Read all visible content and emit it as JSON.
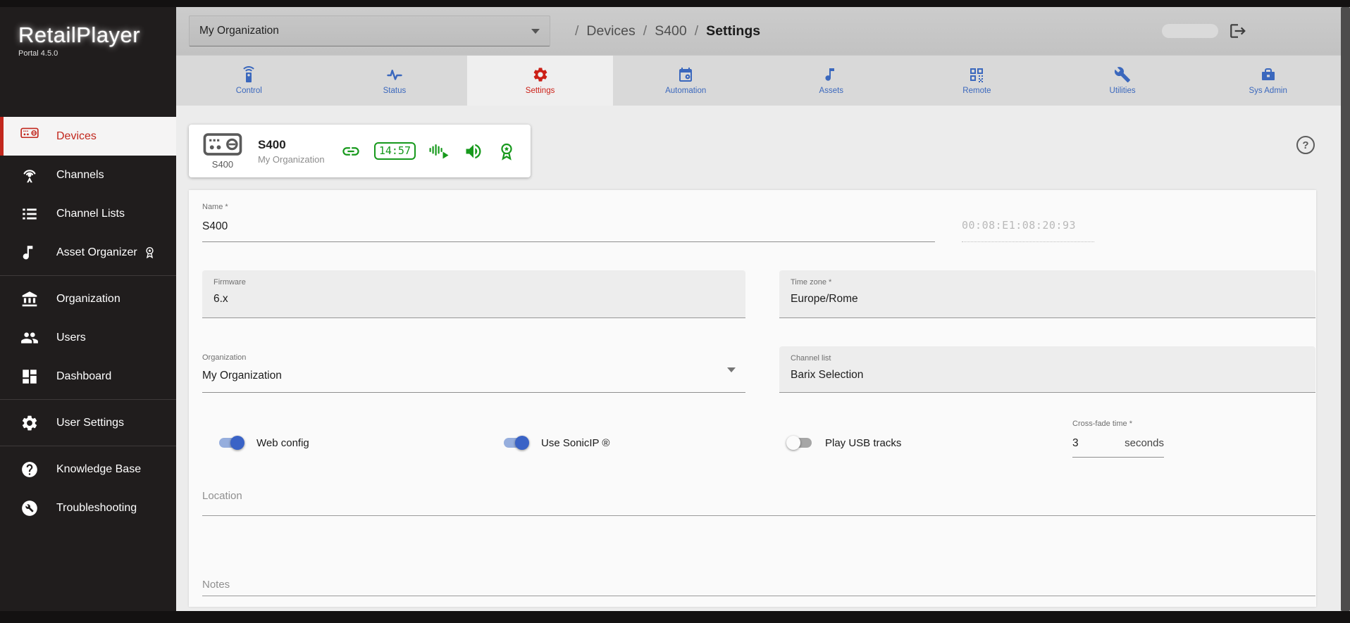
{
  "brand": {
    "name": "RetailPlayer",
    "subtitle": "Portal 4.5.0"
  },
  "topbar": {
    "org_select": {
      "value": "My Organization"
    },
    "breadcrumb": {
      "separator": "/",
      "items": [
        "Devices",
        "S400",
        "Settings"
      ]
    }
  },
  "sidebar": {
    "items": [
      {
        "label": "Devices",
        "icon": "player-icon",
        "active": true
      },
      {
        "label": "Channels",
        "icon": "broadcast-icon",
        "active": false
      },
      {
        "label": "Channel Lists",
        "icon": "list-icon",
        "active": false
      },
      {
        "label": "Asset Organizer",
        "icon": "music-note-icon",
        "badge_icon": "award-badge-icon",
        "active": false
      },
      {
        "label": "Organization",
        "icon": "bank-icon",
        "active": false
      },
      {
        "label": "Users",
        "icon": "users-icon",
        "active": false
      },
      {
        "label": "Dashboard",
        "icon": "dashboard-icon",
        "active": false
      },
      {
        "label": "User Settings",
        "icon": "gear-icon",
        "active": false
      },
      {
        "label": "Knowledge Base",
        "icon": "help-circle-icon",
        "active": false
      },
      {
        "label": "Troubleshooting",
        "icon": "wrench-circle-icon",
        "active": false
      }
    ]
  },
  "tabs": [
    {
      "label": "Control",
      "icon": "remote-control-icon",
      "active": false
    },
    {
      "label": "Status",
      "icon": "pulse-icon",
      "active": false
    },
    {
      "label": "Settings",
      "icon": "gear-icon",
      "active": true
    },
    {
      "label": "Automation",
      "icon": "calendar-gear-icon",
      "active": false
    },
    {
      "label": "Assets",
      "icon": "music-note-icon",
      "active": false
    },
    {
      "label": "Remote",
      "icon": "qr-code-icon",
      "active": false
    },
    {
      "label": "Utilities",
      "icon": "wrench-icon",
      "active": false
    },
    {
      "label": "Sys Admin",
      "icon": "toolbox-icon",
      "active": false
    }
  ],
  "device_card": {
    "model_caption": "S400",
    "title": "S400",
    "subtitle": "My Organization",
    "clock": "14:57",
    "status_icons": [
      "link-icon",
      "clock-badge",
      "waveform-play-icon",
      "speaker-icon",
      "award-badge-icon"
    ]
  },
  "help_glyph": "?",
  "form": {
    "name": {
      "label": "Name *",
      "value": "S400"
    },
    "mac": {
      "value": "00:08:E1:08:20:93"
    },
    "firmware": {
      "label": "Firmware",
      "value": "6.x"
    },
    "timezone": {
      "label": "Time zone *",
      "value": "Europe/Rome"
    },
    "organization": {
      "label": "Organization",
      "value": "My Organization"
    },
    "channel_list": {
      "label": "Channel list",
      "value": "Barix Selection"
    },
    "toggles": [
      {
        "label": "Web config",
        "on": true
      },
      {
        "label": "Use SonicIP ®",
        "on": true
      },
      {
        "label": "Play USB tracks",
        "on": false
      }
    ],
    "crossfade": {
      "label": "Cross-fade time *",
      "value": "3",
      "suffix": "seconds"
    },
    "location": {
      "label": "Location",
      "value": ""
    },
    "notes": {
      "label": "Notes",
      "value": ""
    }
  },
  "colors": {
    "accent_blue": "#3b68bd",
    "accent_red": "#c2271d",
    "accent_green": "#17991c",
    "sidebar_bg": "#201d1d",
    "header_gray": "#c6c6c6"
  }
}
